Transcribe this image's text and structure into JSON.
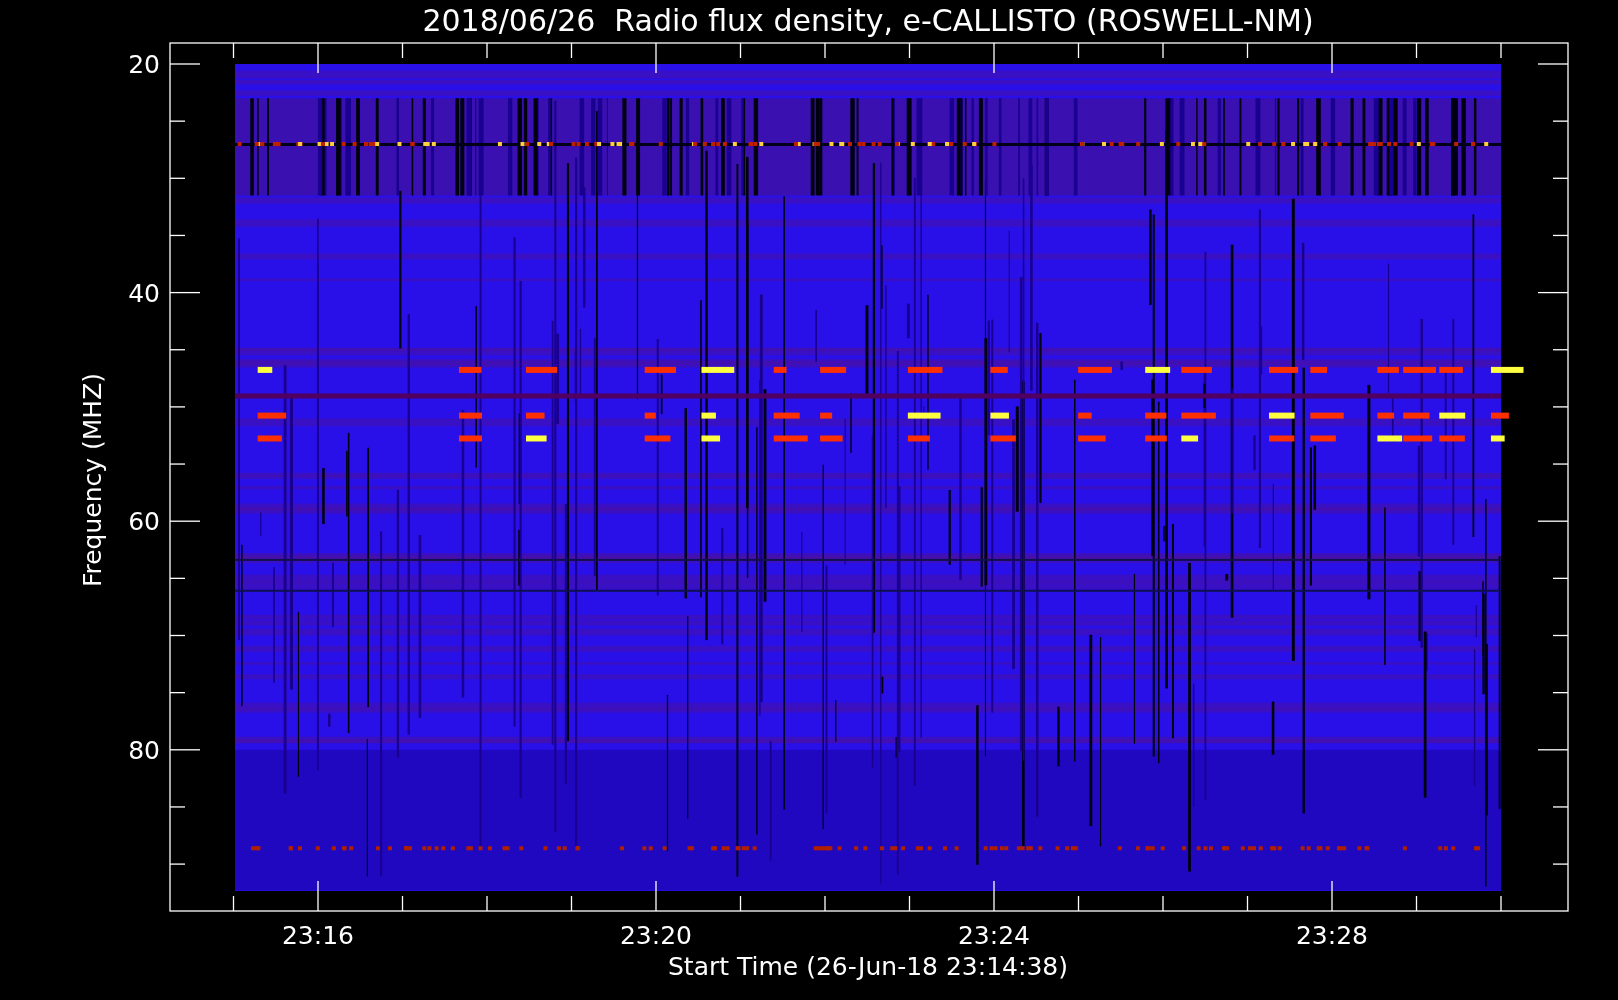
{
  "title": "2018/06/26  Radio flux density, e-CALLISTO (ROSWELL-NM)",
  "x_axis": {
    "label": "Start Time (26-Jun-18 23:14:38)",
    "ticks": [
      "23:16",
      "23:20",
      "23:24",
      "23:28"
    ]
  },
  "y_axis": {
    "label": "Frequency (MHZ)",
    "ticks": [
      "20",
      "40",
      "60",
      "80"
    ]
  }
}
